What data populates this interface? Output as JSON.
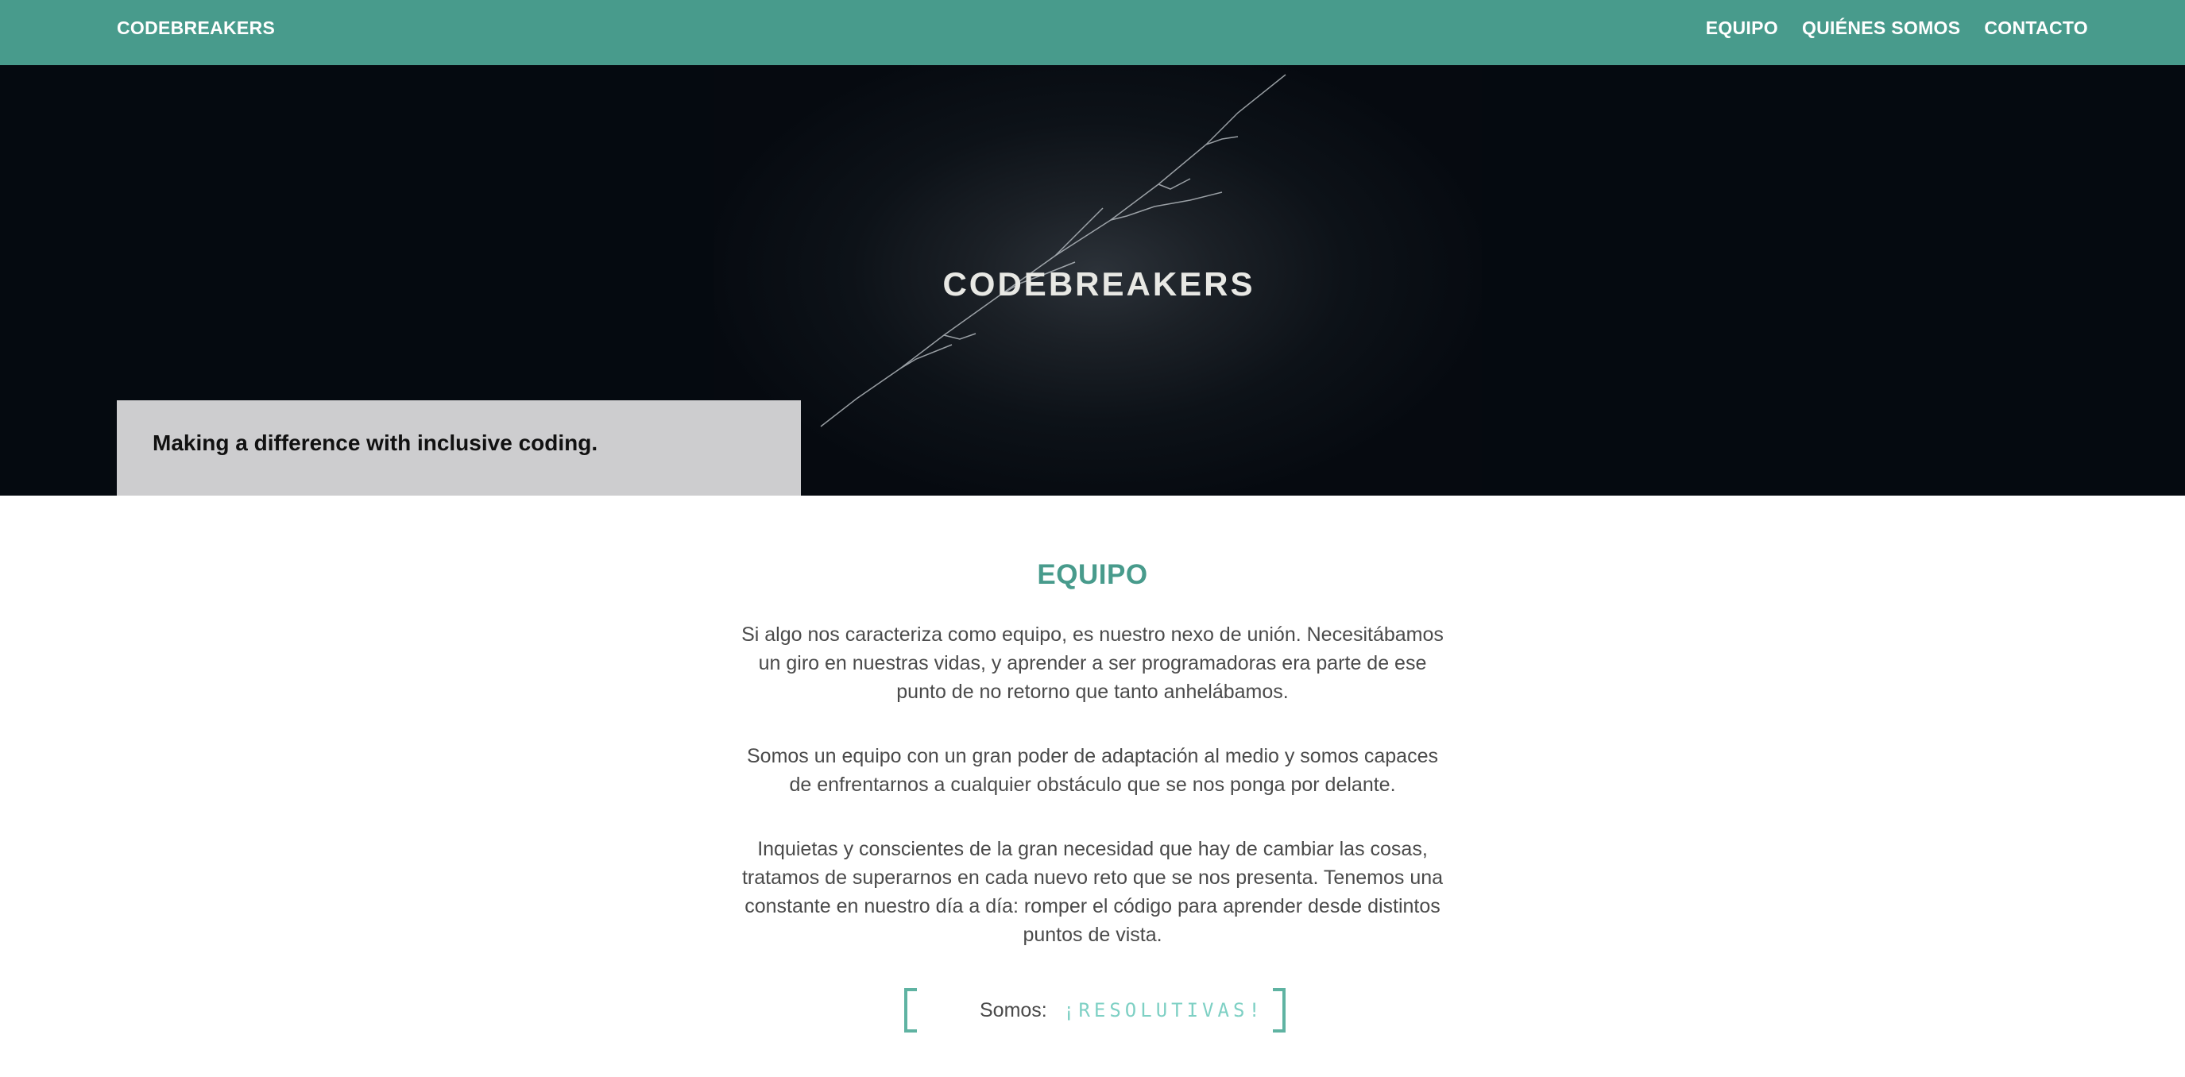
{
  "navbar": {
    "brand": "CODEBREAKERS",
    "links": [
      "EQUIPO",
      "QUIÉNES SOMOS",
      "CONTACTO"
    ]
  },
  "hero": {
    "image_text": "CODEBREAKERS",
    "tagline": "Making a difference with inclusive coding."
  },
  "equipo": {
    "title": "EQUIPO",
    "paragraphs": [
      "Si algo nos caracteriza como equipo, es nuestro nexo de unión. Necesitábamos un giro en nuestras vidas, y aprender a ser programadoras era parte de ese punto de no retorno que tanto anhelábamos.",
      "Somos un equipo con un gran poder de adaptación al medio y somos capaces de enfrentarnos a cualquier obstáculo que se nos ponga por delante.",
      "Inquietas y conscientes de la gran necesidad que hay de cambiar las cosas, tratamos de superarnos en cada nuevo reto que se nos presenta. Tenemos una constante en nuestro día a día: romper el código para aprender desde distintos puntos de vista."
    ],
    "somos_label": "Somos:",
    "somos_word": "¡RESOLUTIVAS!"
  },
  "colors": {
    "navbar_bg": "#489b8c",
    "accent": "#489b8c",
    "somos_word": "#7ed0c4",
    "hero_bg": "#050a10",
    "tagline_bg": "#cdcdcf"
  }
}
